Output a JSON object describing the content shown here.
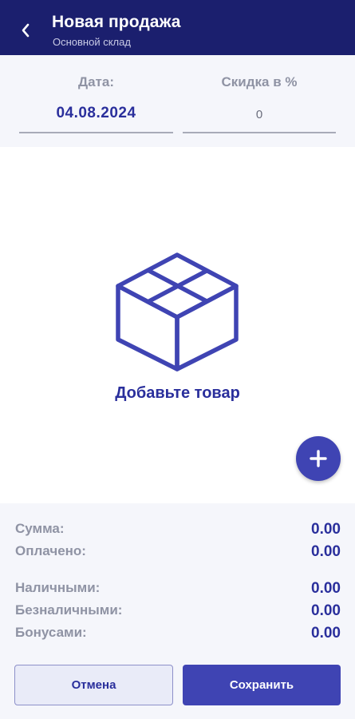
{
  "header": {
    "title": "Новая продажа",
    "subtitle": "Основной склад",
    "back_icon": "chevron-left-icon"
  },
  "fields": {
    "date": {
      "label": "Дата:",
      "value": "04.08.2024"
    },
    "discount": {
      "label": "Скидка в %",
      "value": "",
      "placeholder": "0"
    }
  },
  "empty_state": {
    "icon": "box-icon",
    "label": "Добавьте товар"
  },
  "fab": {
    "icon": "plus-icon"
  },
  "summary": {
    "total": {
      "label": "Сумма:",
      "value": "0.00"
    },
    "paid": {
      "label": "Оплачено:",
      "value": "0.00"
    },
    "cash": {
      "label": "Наличными:",
      "value": "0.00"
    },
    "cashless": {
      "label": "Безналичными:",
      "value": "0.00"
    },
    "bonuses": {
      "label": "Бонусами:",
      "value": "0.00"
    }
  },
  "actions": {
    "cancel_label": "Отмена",
    "save_label": "Сохранить"
  },
  "colors": {
    "appbar": "#1b1f6e",
    "accent": "#3f44b3",
    "accent_text": "#2a2f9c",
    "muted_label": "#8f93a4",
    "panel_bg": "#f5f6fb"
  }
}
